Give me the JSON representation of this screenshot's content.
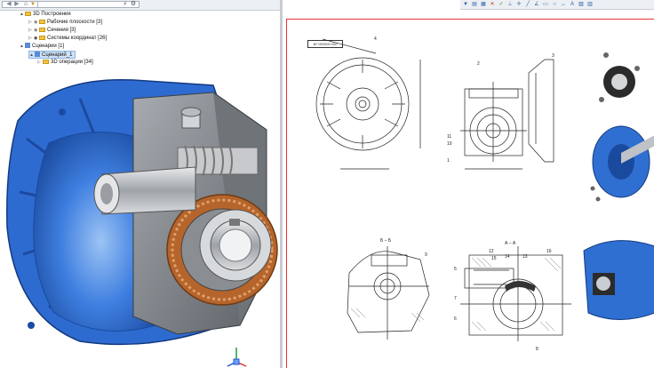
{
  "tree": {
    "items": [
      {
        "label": "3D Построения",
        "indent": 1,
        "arrow": "▲",
        "kind": "folder"
      },
      {
        "label": "Рабочие плоскости [3]",
        "indent": 2,
        "arrow": "▷",
        "kind": "folder-eye"
      },
      {
        "label": "Сечения [3]",
        "indent": 2,
        "arrow": "▷",
        "kind": "folder-eye"
      },
      {
        "label": "Системы координат [26]",
        "indent": 2,
        "arrow": "▷",
        "kind": "folder-eye"
      },
      {
        "label": "Сценарии [1]",
        "indent": 1,
        "arrow": "▲",
        "kind": "scenario"
      },
      {
        "label": "Сценарий_1",
        "indent": 2,
        "arrow": "▲",
        "kind": "scenario-selected"
      },
      {
        "label": "3D операции [34]",
        "indent": 3,
        "arrow": "▷",
        "kind": "folder"
      }
    ]
  },
  "drawing": {
    "title_cell": "ВГ.000000.000",
    "labels": {
      "l4": "4",
      "l2": "2",
      "l3": "3",
      "l11": "11",
      "l10": "10",
      "l1": "1",
      "lB": "Б – Б",
      "lA": "А – А",
      "l9": "9",
      "l12": "12",
      "l13": "13",
      "l14": "14",
      "l15": "15",
      "l16": "16",
      "l5": "5",
      "l7": "7",
      "l6": "6",
      "l8": "8"
    }
  },
  "colors": {
    "blue_housing": "#2f6fd1",
    "blue_dark": "#1d4c9a",
    "gray_body": "#8b8f94",
    "bronze": "#b5652c",
    "steel": "#c9ccd0",
    "red_border": "#e33333"
  },
  "icons": {
    "back": "◀",
    "forward": "▶",
    "home": "⌂",
    "search": "⌕",
    "gear": "⚙"
  }
}
